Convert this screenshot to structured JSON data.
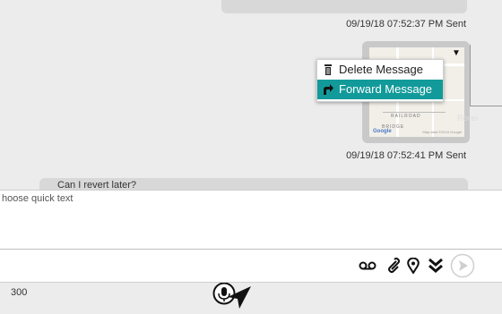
{
  "chat": {
    "timestamp_1": "09/19/18 07:52:37 PM Sent",
    "timestamp_2": "09/19/18 07:52:41 PM Sent",
    "next_message_preview": "Can I revert later?",
    "map_labels": {
      "railroad": "RAILROAD",
      "bridge": "BRIDGE",
      "google": "Google",
      "copyright": "Map data ©2018 Google"
    }
  },
  "context_menu": {
    "items": [
      {
        "label": "Delete Message",
        "icon": "trash-icon",
        "active": false
      },
      {
        "label": "Forward Message",
        "icon": "forward-arrow-icon",
        "active": true
      }
    ],
    "active_color": "#129a9a"
  },
  "compose": {
    "placeholder": "hoose quick text"
  },
  "toolbar": {
    "icons": [
      "voicemail-icon",
      "paperclip-icon",
      "location-pin-icon",
      "double-chevron-down-icon",
      "send-icon"
    ]
  },
  "footer": {
    "char_count": "300",
    "icons": [
      "microphone-icon",
      "navigation-arrow-icon"
    ]
  }
}
